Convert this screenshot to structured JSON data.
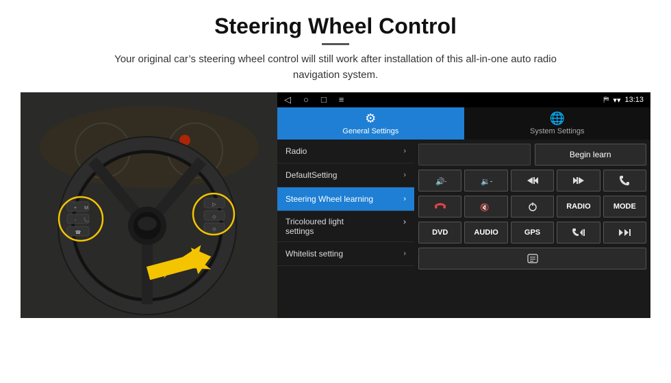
{
  "header": {
    "title": "Steering Wheel Control",
    "subtitle": "Your original car’s steering wheel control will still work after installation of this all-in-one auto radio navigation system."
  },
  "status_bar": {
    "nav_icons": [
      "◁",
      "○",
      "□",
      "≡"
    ],
    "right_items": [
      "⚿",
      "▾",
      "▾",
      "13:13"
    ]
  },
  "tabs": [
    {
      "label": "General Settings",
      "icon": "⚙",
      "active": true
    },
    {
      "label": "System Settings",
      "icon": "⭒",
      "active": false
    }
  ],
  "menu_items": [
    {
      "label": "Radio",
      "multiline": false,
      "active": false
    },
    {
      "label": "DefaultSetting",
      "multiline": false,
      "active": false
    },
    {
      "label": "Steering Wheel learning",
      "multiline": false,
      "active": true
    },
    {
      "label": "Tricoloured light settings",
      "multiline": true,
      "active": false
    },
    {
      "label": "Whitelist setting",
      "multiline": false,
      "active": false
    }
  ],
  "controls": {
    "top_row": {
      "empty_box": "",
      "begin_learn": "Begin learn"
    },
    "row2": [
      "🔊+",
      "🔉−",
      "⏮",
      "⏭",
      "☎"
    ],
    "row3": [
      "✆",
      "🔇×",
      "⏻",
      "RADIO",
      "MODE"
    ],
    "row4": [
      "DVD",
      "AUDIO",
      "GPS",
      "☎⏮",
      "↘⏭"
    ],
    "row5": [
      "🖶"
    ]
  }
}
